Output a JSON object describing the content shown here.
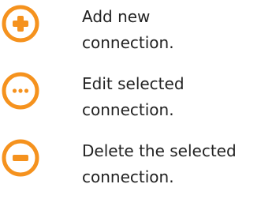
{
  "accent_color": "#f5921e",
  "legend": {
    "items": [
      {
        "icon": "add-icon",
        "line1": "Add new",
        "line2": "connection."
      },
      {
        "icon": "edit-icon",
        "line1": "Edit selected",
        "line2": "connection."
      },
      {
        "icon": "delete-icon",
        "line1": "Delete the selected",
        "line2": "connection."
      }
    ]
  }
}
